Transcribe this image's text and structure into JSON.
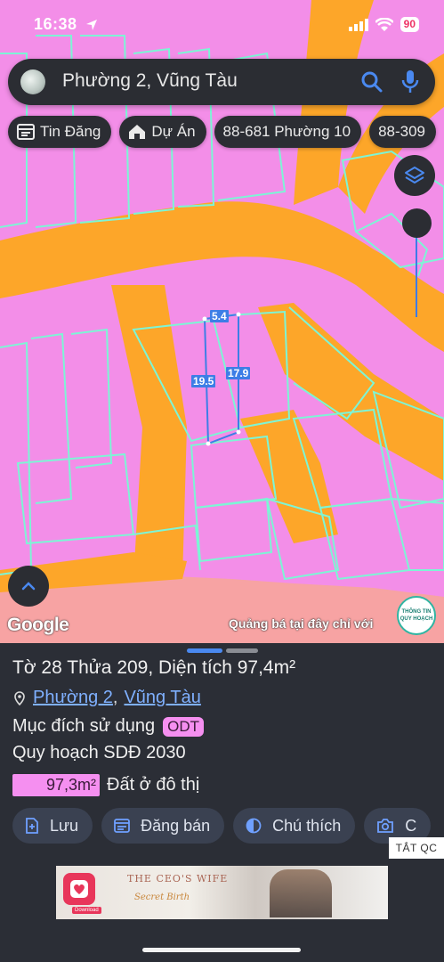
{
  "status_bar": {
    "time": "16:38",
    "battery": "90"
  },
  "search": {
    "query": "Phường 2, Vũng Tàu"
  },
  "chips": [
    {
      "label": "Tin Đăng",
      "icon": "listing-icon"
    },
    {
      "label": "Dự Án",
      "icon": "house-icon"
    },
    {
      "label": "88-681 Phường 10",
      "icon": ""
    },
    {
      "label": "88-309",
      "icon": ""
    }
  ],
  "map": {
    "google_label": "Google",
    "promo_text": "Quảng bá tại đây chỉ với",
    "badge_line1": "THÔNG TIN",
    "badge_line2": "QUY HOẠCH",
    "measurements": {
      "top": "5.4",
      "left": "19.5",
      "right": "17.9"
    },
    "colors": {
      "residential": "#f38ee8",
      "road": "#fda629",
      "outline": "#7df5d5",
      "boundary": "#3d7ee6"
    }
  },
  "panel": {
    "title": "Tờ 28 Thửa 209, Diện tích 97,4m²",
    "location_ward": "Phường 2",
    "location_sep": ",",
    "location_city": "Vũng Tàu",
    "purpose_label": "Mục đích sử dụng",
    "purpose_code": "ODT",
    "plan_label": "Quy hoạch SDĐ 2030",
    "area_value": "97,3m²",
    "area_label": "Đất ở đô thị",
    "actions": [
      {
        "label": "Lưu",
        "icon": "save-plus-icon"
      },
      {
        "label": "Đăng bán",
        "icon": "listing-icon"
      },
      {
        "label": "Chú thích",
        "icon": "contrast-icon"
      },
      {
        "label": "C",
        "icon": "camera-icon"
      }
    ],
    "ad_close": "TẮT QC",
    "ad": {
      "title": "THE CEO'S WIFE",
      "subtitle": "Secret Birth",
      "download": "Download"
    }
  }
}
